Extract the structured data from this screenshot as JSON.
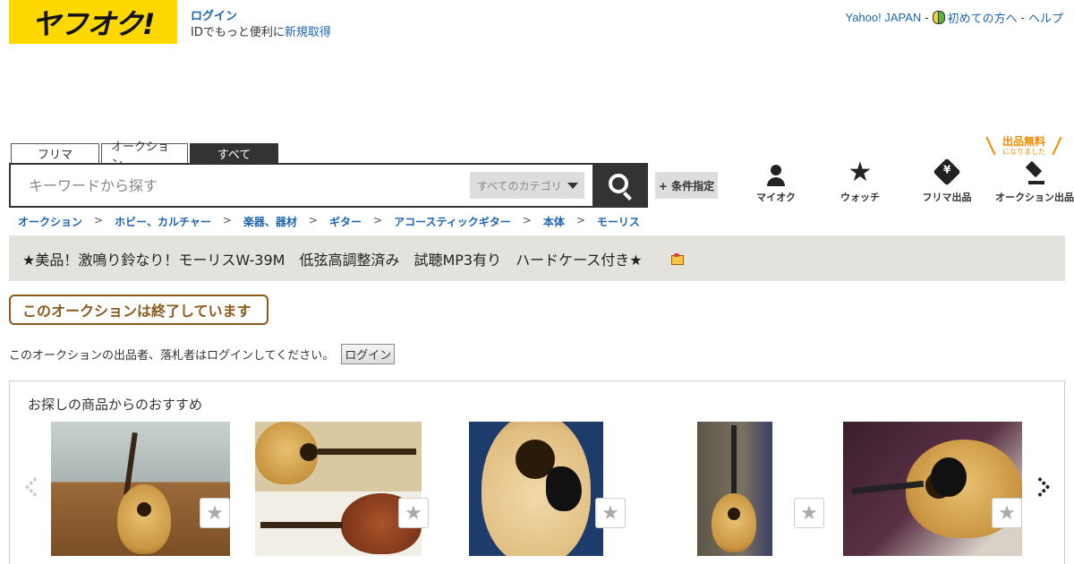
{
  "header": {
    "logo_text": "ヤフオク!",
    "login_label": "ログイン",
    "id_prompt": "IDでもっと便利に",
    "register_label": "新規取得",
    "yahoo_japan": "Yahoo! JAPAN",
    "first_time": "初めての方へ",
    "help": "ヘルプ",
    "separator": "-"
  },
  "search": {
    "tabs": [
      "フリマ",
      "オークション",
      "すべて"
    ],
    "active_tab": "すべて",
    "placeholder": "キーワードから探す",
    "category": "すべてのカテゴリ",
    "conditions_label": "+ 条件指定"
  },
  "nav": {
    "items": [
      "マイオク",
      "ウォッチ",
      "フリマ出品",
      "オークション出品"
    ],
    "free_label": "出品無料",
    "free_sub": "になりました"
  },
  "breadcrumb": [
    "オークション",
    "ホビー、カルチャー",
    "楽器、器材",
    "ギター",
    "アコースティックギター",
    "本体",
    "モーリス"
  ],
  "breadcrumb_sep": ">",
  "item": {
    "title": "★美品！激鳴り鈴なり！モーリスW-39M　低弦高調整済み　試聴MP3有り　ハードケース付き★",
    "ended_label": "このオークションは終了しています",
    "login_notice": "このオークションの出品者、落札者はログインしてください。",
    "login_button": "ログイン"
  },
  "recommendations": {
    "title": "お探しの商品からのおすすめ",
    "items_count": 5
  },
  "colors": {
    "brand_yellow": "#ffd800",
    "link_blue": "#1e65b0",
    "ended_brown": "#8a5a1e",
    "free_orange": "#f08c00"
  }
}
